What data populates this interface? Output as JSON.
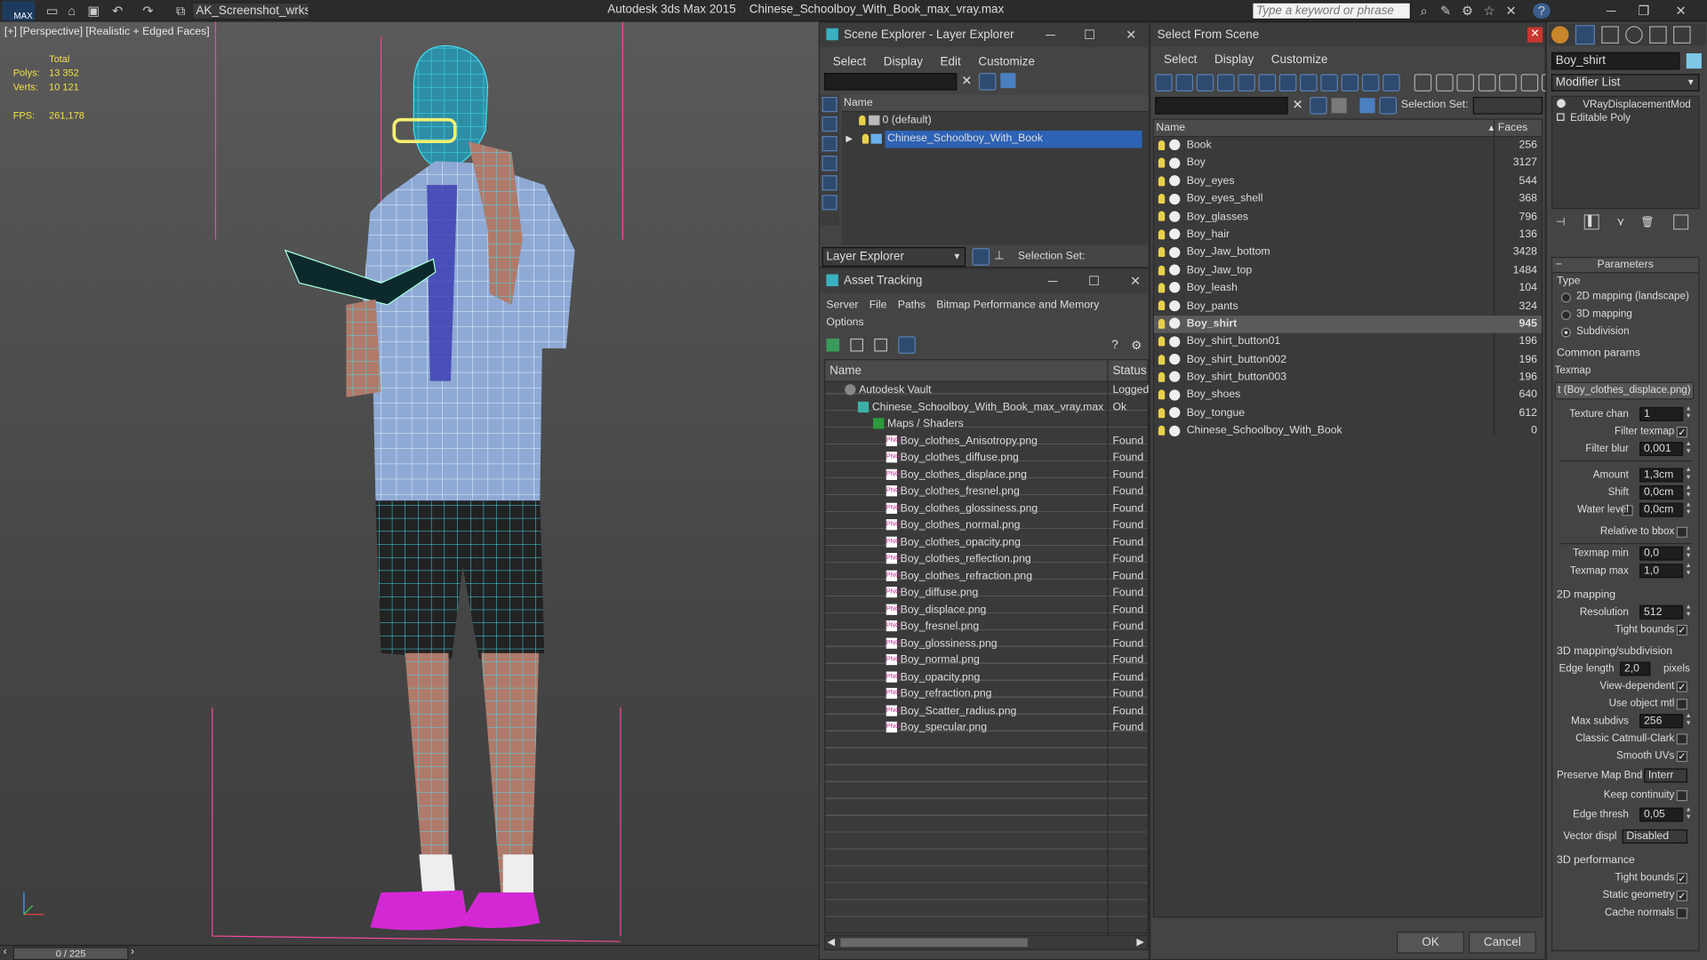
{
  "app": {
    "title": "Autodesk 3ds Max  2015",
    "file": "Chinese_Schoolboy_With_Book_max_vray.max",
    "workspace": "AK_Screenshot_wrksp",
    "search_placeholder": "Type a keyword or phrase",
    "logo": "MAX"
  },
  "viewport": {
    "label": "[+] [Perspective] [Realistic + Edged Faces]",
    "stats": {
      "total_label": "Total",
      "polys_label": "Polys:",
      "polys": "13 352",
      "verts_label": "Verts:",
      "verts": "10 121",
      "fps_label": "FPS:",
      "fps": "261,178"
    },
    "timeline": "0 / 225"
  },
  "scene_explorer": {
    "title": "Scene Explorer - Layer Explorer",
    "menu": [
      "Select",
      "Display",
      "Edit",
      "Customize"
    ],
    "col_name": "Name",
    "layers": [
      "0 (default)",
      "Chinese_Schoolboy_With_Book"
    ],
    "footer_dropdown": "Layer Explorer",
    "selection_set": "Selection Set:"
  },
  "asset_tracking": {
    "title": "Asset Tracking",
    "menu": [
      "Server",
      "File",
      "Paths",
      "Bitmap Performance and Memory",
      "Options"
    ],
    "col_name": "Name",
    "col_status": "Status",
    "rows": [
      {
        "name": "Autodesk Vault",
        "status": "Logged",
        "level": 0
      },
      {
        "name": "Chinese_Schoolboy_With_Book_max_vray.max",
        "status": "Ok",
        "level": 1
      },
      {
        "name": "Maps / Shaders",
        "status": "",
        "level": 2
      },
      {
        "name": "Boy_clothes_Anisotropy.png",
        "status": "Found",
        "level": 3
      },
      {
        "name": "Boy_clothes_diffuse.png",
        "status": "Found",
        "level": 3
      },
      {
        "name": "Boy_clothes_displace.png",
        "status": "Found",
        "level": 3
      },
      {
        "name": "Boy_clothes_fresnel.png",
        "status": "Found",
        "level": 3
      },
      {
        "name": "Boy_clothes_glossiness.png",
        "status": "Found",
        "level": 3
      },
      {
        "name": "Boy_clothes_normal.png",
        "status": "Found",
        "level": 3
      },
      {
        "name": "Boy_clothes_opacity.png",
        "status": "Found",
        "level": 3
      },
      {
        "name": "Boy_clothes_reflection.png",
        "status": "Found",
        "level": 3
      },
      {
        "name": "Boy_clothes_refraction.png",
        "status": "Found",
        "level": 3
      },
      {
        "name": "Boy_diffuse.png",
        "status": "Found",
        "level": 3
      },
      {
        "name": "Boy_displace.png",
        "status": "Found",
        "level": 3
      },
      {
        "name": "Boy_fresnel.png",
        "status": "Found",
        "level": 3
      },
      {
        "name": "Boy_glossiness.png",
        "status": "Found",
        "level": 3
      },
      {
        "name": "Boy_normal.png",
        "status": "Found",
        "level": 3
      },
      {
        "name": "Boy_opacity.png",
        "status": "Found",
        "level": 3
      },
      {
        "name": "Boy_refraction.png",
        "status": "Found",
        "level": 3
      },
      {
        "name": "Boy_Scatter_radius.png",
        "status": "Found",
        "level": 3
      },
      {
        "name": "Boy_specular.png",
        "status": "Found",
        "level": 3
      }
    ]
  },
  "select_from_scene": {
    "title": "Select From Scene",
    "menu": [
      "Select",
      "Display",
      "Customize"
    ],
    "selection_set": "Selection Set:",
    "col_name": "Name",
    "col_faces": "Faces",
    "objects": [
      {
        "name": "Book",
        "faces": "256"
      },
      {
        "name": "Boy",
        "faces": "3127"
      },
      {
        "name": "Boy_eyes",
        "faces": "544"
      },
      {
        "name": "Boy_eyes_shell",
        "faces": "368"
      },
      {
        "name": "Boy_glasses",
        "faces": "796"
      },
      {
        "name": "Boy_hair",
        "faces": "136"
      },
      {
        "name": "Boy_Jaw_bottom",
        "faces": "3428"
      },
      {
        "name": "Boy_Jaw_top",
        "faces": "1484"
      },
      {
        "name": "Boy_leash",
        "faces": "104"
      },
      {
        "name": "Boy_pants",
        "faces": "324"
      },
      {
        "name": "Boy_shirt",
        "faces": "945",
        "selected": true
      },
      {
        "name": "Boy_shirt_button01",
        "faces": "196"
      },
      {
        "name": "Boy_shirt_button002",
        "faces": "196"
      },
      {
        "name": "Boy_shirt_button003",
        "faces": "196"
      },
      {
        "name": "Boy_shoes",
        "faces": "640"
      },
      {
        "name": "Boy_tongue",
        "faces": "612"
      },
      {
        "name": "Chinese_Schoolboy_With_Book",
        "faces": "0"
      }
    ],
    "ok": "OK",
    "cancel": "Cancel"
  },
  "modifier_panel": {
    "object_name": "Boy_shirt",
    "modifier_list": "Modifier List",
    "stack": [
      "VRayDisplacementMod",
      "Editable Poly"
    ],
    "rollout": "Parameters",
    "type_label": "Type",
    "types": [
      "2D mapping (landscape)",
      "3D mapping",
      "Subdivision"
    ],
    "common_params": "Common params",
    "texmap_label": "Texmap",
    "texmap": "t (Boy_clothes_displace.png)",
    "texture_chan_label": "Texture chan",
    "texture_chan": "1",
    "filter_texmap": "Filter texmap",
    "filter_blur_label": "Filter blur",
    "filter_blur": "0,001",
    "amount_label": "Amount",
    "amount": "1,3cm",
    "shift_label": "Shift",
    "shift": "0,0cm",
    "water_level_label": "Water level",
    "water_level": "0,0cm",
    "relative_bbox": "Relative to bbox",
    "texmap_min_label": "Texmap min",
    "texmap_min": "0,0",
    "texmap_max_label": "Texmap max",
    "texmap_max": "1,0",
    "mapping2d": "2D mapping",
    "resolution_label": "Resolution",
    "resolution": "512",
    "tight_bounds": "Tight bounds",
    "mapping3d": "3D mapping/subdivision",
    "edge_length_label": "Edge length",
    "edge_length": "2,0",
    "pixels": "pixels",
    "view_dependent": "View-dependent",
    "use_object_mtl": "Use object mtl",
    "max_subdivs_label": "Max subdivs",
    "max_subdivs": "256",
    "classic_cc": "Classic Catmull-Clark",
    "smooth_uvs": "Smooth UVs",
    "preserve_map_bnd": "Preserve Map Bnd",
    "preserve_value": "Interr",
    "keep_continuity": "Keep continuity",
    "edge_thresh_label": "Edge thresh",
    "edge_thresh": "0,05",
    "vector_displ_label": "Vector displ",
    "vector_displ": "Disabled",
    "perf": "3D performance",
    "tight_bounds2": "Tight bounds",
    "static_geometry": "Static geometry",
    "cache_normals": "Cache normals"
  },
  "colors": {
    "accent": "#2d62b5",
    "wire": "#44e0f0",
    "shoe": "#d428d4",
    "bg": "#444444"
  }
}
